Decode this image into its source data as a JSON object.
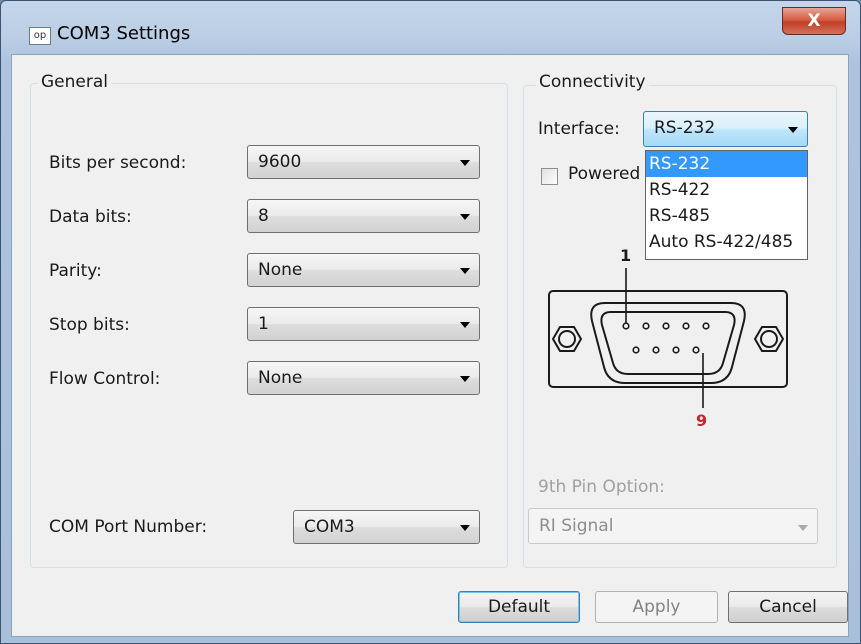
{
  "window": {
    "title": "COM3 Settings",
    "icon_text": "op",
    "close_label": "X"
  },
  "general": {
    "legend": "General",
    "fields": [
      {
        "label": "Bits per second:",
        "value": "9600"
      },
      {
        "label": "Data bits:",
        "value": "8"
      },
      {
        "label": "Parity:",
        "value": "None"
      },
      {
        "label": "Stop bits:",
        "value": "1"
      },
      {
        "label": "Flow Control:",
        "value": "None"
      }
    ],
    "com_port": {
      "label": "COM Port Number:",
      "value": "COM3"
    }
  },
  "connectivity": {
    "legend": "Connectivity",
    "interface_label": "Interface:",
    "interface_value": "RS-232",
    "interface_options": [
      "RS-232",
      "RS-422",
      "RS-485",
      "Auto RS-422/485"
    ],
    "powered_label": "Powered",
    "powered_checked": false,
    "pin_first": "1",
    "pin_last": "9",
    "ninth_pin_label": "9th Pin Option:",
    "ninth_pin_value": "RI Signal"
  },
  "buttons": {
    "default": "Default",
    "apply": "Apply",
    "cancel": "Cancel"
  },
  "colors": {
    "selection": "#3399ff",
    "pin9": "#c0282d",
    "close": "#c9432b"
  }
}
